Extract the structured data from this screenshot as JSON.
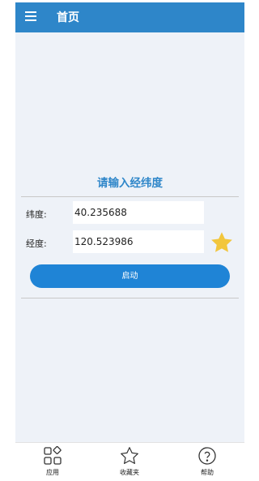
{
  "appbar": {
    "title": "首页",
    "menu_icon": "hamburger-menu-icon"
  },
  "form": {
    "prompt": "请输入经纬度",
    "latitude": {
      "label": "纬度:",
      "value": "40.235688"
    },
    "longitude": {
      "label": "经度:",
      "value": "120.523986"
    },
    "favorite_icon": "star-icon",
    "start_label": "启动"
  },
  "bottom_nav": {
    "items": [
      {
        "label": "应用",
        "icon": "apps-grid-icon"
      },
      {
        "label": "收藏夹",
        "icon": "star-outline-icon"
      },
      {
        "label": "帮助",
        "icon": "help-circle-icon"
      }
    ]
  },
  "colors": {
    "primary": "#2e86c9",
    "button": "#1f84d6",
    "star": "#f2c63c",
    "background": "#eef2f8"
  }
}
